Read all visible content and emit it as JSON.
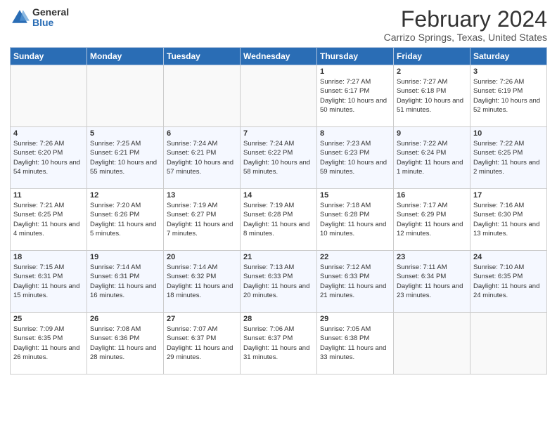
{
  "header": {
    "logo": {
      "general": "General",
      "blue": "Blue"
    },
    "title": "February 2024",
    "location": "Carrizo Springs, Texas, United States"
  },
  "weekdays": [
    "Sunday",
    "Monday",
    "Tuesday",
    "Wednesday",
    "Thursday",
    "Friday",
    "Saturday"
  ],
  "weeks": [
    [
      {
        "day": "",
        "info": ""
      },
      {
        "day": "",
        "info": ""
      },
      {
        "day": "",
        "info": ""
      },
      {
        "day": "",
        "info": ""
      },
      {
        "day": "1",
        "info": "Sunrise: 7:27 AM\nSunset: 6:17 PM\nDaylight: 10 hours\nand 50 minutes."
      },
      {
        "day": "2",
        "info": "Sunrise: 7:27 AM\nSunset: 6:18 PM\nDaylight: 10 hours\nand 51 minutes."
      },
      {
        "day": "3",
        "info": "Sunrise: 7:26 AM\nSunset: 6:19 PM\nDaylight: 10 hours\nand 52 minutes."
      }
    ],
    [
      {
        "day": "4",
        "info": "Sunrise: 7:26 AM\nSunset: 6:20 PM\nDaylight: 10 hours\nand 54 minutes."
      },
      {
        "day": "5",
        "info": "Sunrise: 7:25 AM\nSunset: 6:21 PM\nDaylight: 10 hours\nand 55 minutes."
      },
      {
        "day": "6",
        "info": "Sunrise: 7:24 AM\nSunset: 6:21 PM\nDaylight: 10 hours\nand 57 minutes."
      },
      {
        "day": "7",
        "info": "Sunrise: 7:24 AM\nSunset: 6:22 PM\nDaylight: 10 hours\nand 58 minutes."
      },
      {
        "day": "8",
        "info": "Sunrise: 7:23 AM\nSunset: 6:23 PM\nDaylight: 10 hours\nand 59 minutes."
      },
      {
        "day": "9",
        "info": "Sunrise: 7:22 AM\nSunset: 6:24 PM\nDaylight: 11 hours\nand 1 minute."
      },
      {
        "day": "10",
        "info": "Sunrise: 7:22 AM\nSunset: 6:25 PM\nDaylight: 11 hours\nand 2 minutes."
      }
    ],
    [
      {
        "day": "11",
        "info": "Sunrise: 7:21 AM\nSunset: 6:25 PM\nDaylight: 11 hours\nand 4 minutes."
      },
      {
        "day": "12",
        "info": "Sunrise: 7:20 AM\nSunset: 6:26 PM\nDaylight: 11 hours\nand 5 minutes."
      },
      {
        "day": "13",
        "info": "Sunrise: 7:19 AM\nSunset: 6:27 PM\nDaylight: 11 hours\nand 7 minutes."
      },
      {
        "day": "14",
        "info": "Sunrise: 7:19 AM\nSunset: 6:28 PM\nDaylight: 11 hours\nand 8 minutes."
      },
      {
        "day": "15",
        "info": "Sunrise: 7:18 AM\nSunset: 6:28 PM\nDaylight: 11 hours\nand 10 minutes."
      },
      {
        "day": "16",
        "info": "Sunrise: 7:17 AM\nSunset: 6:29 PM\nDaylight: 11 hours\nand 12 minutes."
      },
      {
        "day": "17",
        "info": "Sunrise: 7:16 AM\nSunset: 6:30 PM\nDaylight: 11 hours\nand 13 minutes."
      }
    ],
    [
      {
        "day": "18",
        "info": "Sunrise: 7:15 AM\nSunset: 6:31 PM\nDaylight: 11 hours\nand 15 minutes."
      },
      {
        "day": "19",
        "info": "Sunrise: 7:14 AM\nSunset: 6:31 PM\nDaylight: 11 hours\nand 16 minutes."
      },
      {
        "day": "20",
        "info": "Sunrise: 7:14 AM\nSunset: 6:32 PM\nDaylight: 11 hours\nand 18 minutes."
      },
      {
        "day": "21",
        "info": "Sunrise: 7:13 AM\nSunset: 6:33 PM\nDaylight: 11 hours\nand 20 minutes."
      },
      {
        "day": "22",
        "info": "Sunrise: 7:12 AM\nSunset: 6:33 PM\nDaylight: 11 hours\nand 21 minutes."
      },
      {
        "day": "23",
        "info": "Sunrise: 7:11 AM\nSunset: 6:34 PM\nDaylight: 11 hours\nand 23 minutes."
      },
      {
        "day": "24",
        "info": "Sunrise: 7:10 AM\nSunset: 6:35 PM\nDaylight: 11 hours\nand 24 minutes."
      }
    ],
    [
      {
        "day": "25",
        "info": "Sunrise: 7:09 AM\nSunset: 6:35 PM\nDaylight: 11 hours\nand 26 minutes."
      },
      {
        "day": "26",
        "info": "Sunrise: 7:08 AM\nSunset: 6:36 PM\nDaylight: 11 hours\nand 28 minutes."
      },
      {
        "day": "27",
        "info": "Sunrise: 7:07 AM\nSunset: 6:37 PM\nDaylight: 11 hours\nand 29 minutes."
      },
      {
        "day": "28",
        "info": "Sunrise: 7:06 AM\nSunset: 6:37 PM\nDaylight: 11 hours\nand 31 minutes."
      },
      {
        "day": "29",
        "info": "Sunrise: 7:05 AM\nSunset: 6:38 PM\nDaylight: 11 hours\nand 33 minutes."
      },
      {
        "day": "",
        "info": ""
      },
      {
        "day": "",
        "info": ""
      }
    ]
  ]
}
